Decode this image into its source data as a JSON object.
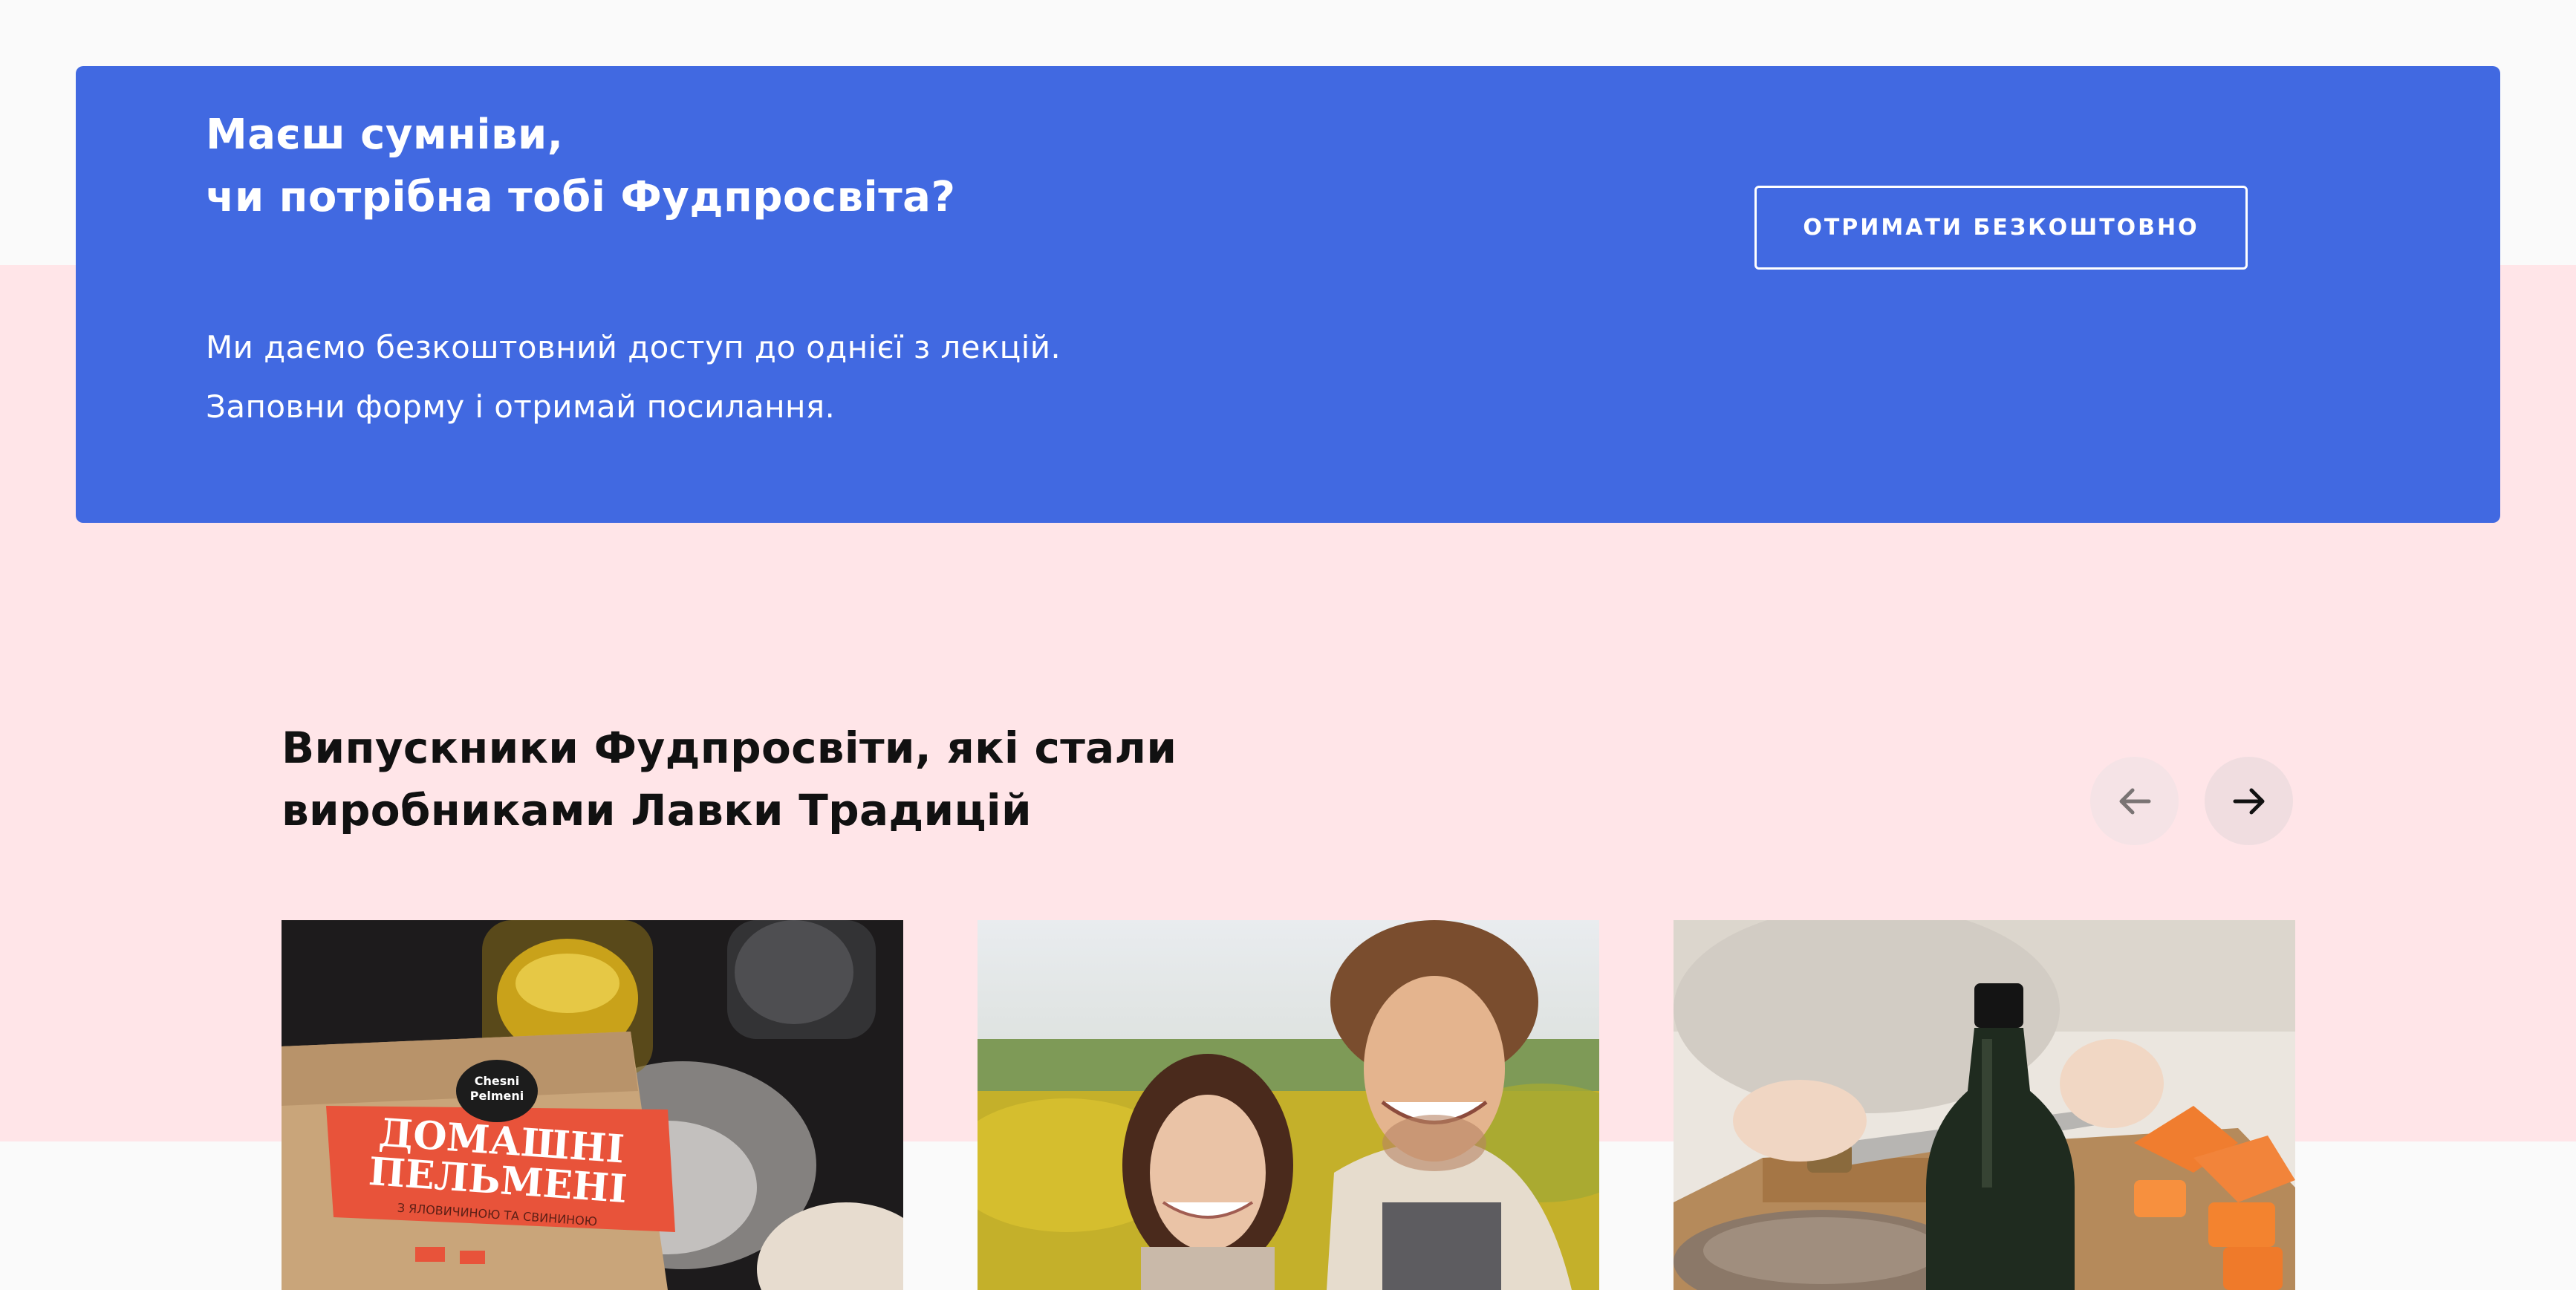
{
  "promo": {
    "title_line1": "Маєш сумніви,",
    "title_line2": "чи потрібна тобі Фудпросвіта?",
    "text_line1": "Ми даємо безкоштовний доступ до однієї з лекцій.",
    "text_line2": "Заповни форму і отримай посилання.",
    "button_label": "ОТРИМАТИ БЕЗКОШТОВНО",
    "background_color": "#4169e1"
  },
  "graduates": {
    "title_line1": "Випускники Фудпросвіти, які стали",
    "title_line2": "виробниками Лавки Традицій",
    "prev_icon": "arrow-left-icon",
    "next_icon": "arrow-right-icon",
    "cards": [
      {
        "image": "dumplings-package-photo",
        "brand_line1": "Chesni",
        "brand_line2": "Pelmeni",
        "package_line1": "ДОМАШНІ",
        "package_line2": "ПЕЛЬМЕНІ",
        "package_subtext": "З ЯЛОВИЧИНОЮ ТА СВИНИНОЮ"
      },
      {
        "image": "couple-portrait-photo"
      },
      {
        "image": "cutting-pumpkin-bottle-photo"
      }
    ]
  },
  "colors": {
    "page_background": "#fafafa",
    "pink_band": "#ffe5e8",
    "accent_blue": "#4169e1",
    "nav_button_bg": "#f2dfe2"
  }
}
